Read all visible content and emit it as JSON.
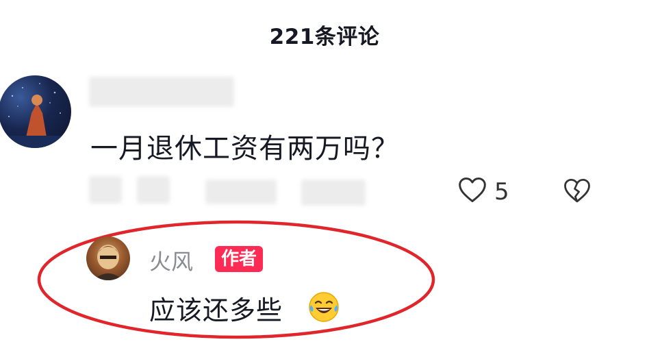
{
  "header": {
    "title": "221条评论"
  },
  "comment": {
    "text": "一月退休工资有两万吗？",
    "like_count": "5"
  },
  "reply": {
    "author_name": "火风",
    "author_badge": "作者",
    "text": "应该还多些"
  },
  "colors": {
    "badge": "#fe2c55",
    "highlight": "#e0262b",
    "text_primary": "#161823",
    "text_secondary": "#8a8b91"
  },
  "icons": [
    "heart-outline-icon",
    "broken-heart-icon",
    "laughing-tears-emoji"
  ]
}
